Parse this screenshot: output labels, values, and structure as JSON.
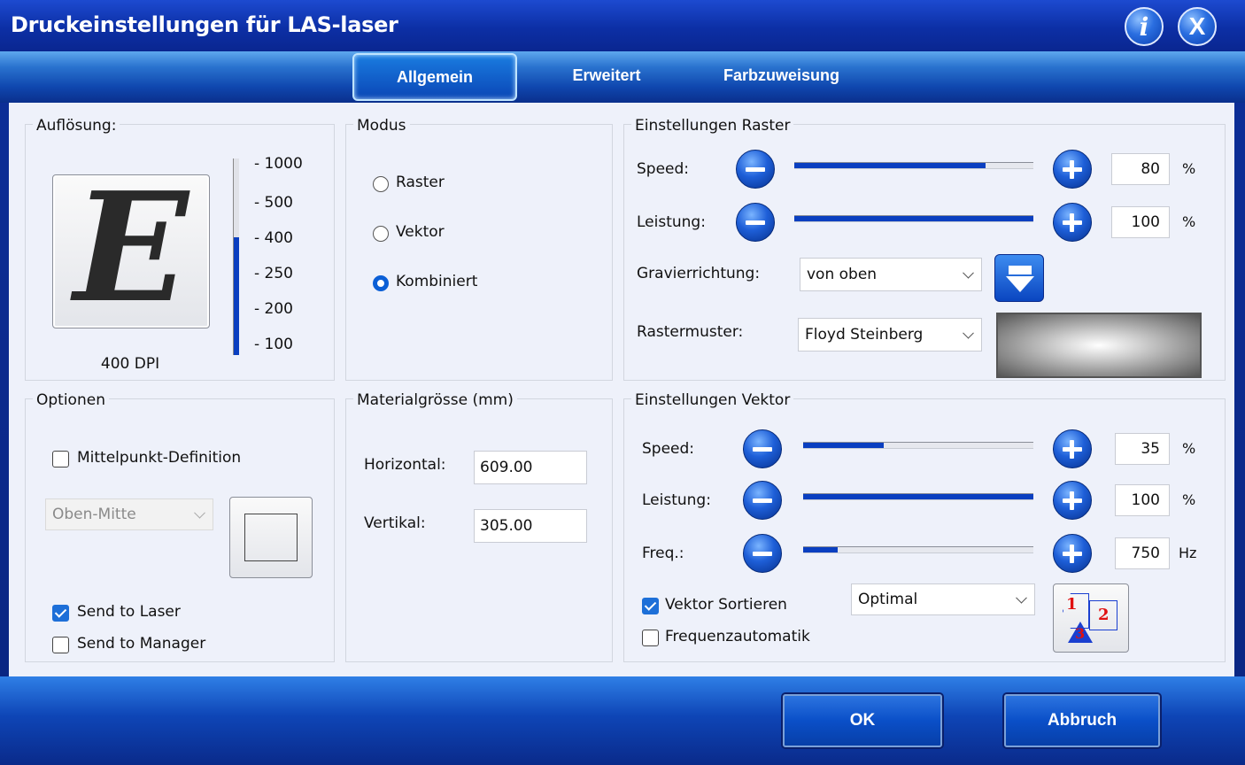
{
  "window": {
    "title": "Druckeinstellungen für LAS-laser",
    "info_label": "i",
    "close_label": "X"
  },
  "tabs": [
    {
      "label": "Allgemein",
      "active": true
    },
    {
      "label": "Erweitert",
      "active": false
    },
    {
      "label": "Farbzuweisung",
      "active": false
    }
  ],
  "resolution": {
    "group_label": "Auflösung:",
    "preview_letter": "E",
    "current": "400 DPI",
    "scale": [
      "1000",
      "500",
      "400",
      "250",
      "200",
      "100"
    ],
    "slider_level_fraction": 0.6
  },
  "modus": {
    "group_label": "Modus",
    "options": [
      {
        "label": "Raster",
        "selected": false
      },
      {
        "label": "Vektor",
        "selected": false
      },
      {
        "label": "Kombiniert",
        "selected": true
      }
    ]
  },
  "raster": {
    "group_label": "Einstellungen Raster",
    "speed_label": "Speed:",
    "speed_value": "80",
    "speed_unit": "%",
    "speed_fraction": 0.8,
    "power_label": "Leistung:",
    "power_value": "100",
    "power_unit": "%",
    "power_fraction": 1.0,
    "direction_label": "Gravierrichtung:",
    "direction_value": "von oben",
    "pattern_label": "Rastermuster:",
    "pattern_value": "Floyd Steinberg"
  },
  "options": {
    "group_label": "Optionen",
    "center_label": "Mittelpunkt-Definition",
    "center_checked": false,
    "position_value": "Oben-Mitte",
    "send_laser_label": "Send to Laser",
    "send_laser_checked": true,
    "send_manager_label": "Send to Manager",
    "send_manager_checked": false
  },
  "material": {
    "group_label": "Materialgrösse (mm)",
    "horizontal_label": "Horizontal:",
    "horizontal_value": "609.00",
    "vertical_label": "Vertikal:",
    "vertical_value": "305.00"
  },
  "vector": {
    "group_label": "Einstellungen Vektor",
    "speed_label": "Speed:",
    "speed_value": "35",
    "speed_unit": "%",
    "speed_fraction": 0.35,
    "power_label": "Leistung:",
    "power_value": "100",
    "power_unit": "%",
    "power_fraction": 1.0,
    "freq_label": "Freq.:",
    "freq_value": "750",
    "freq_unit": "Hz",
    "freq_fraction": 0.15,
    "sort_label": "Vektor Sortieren",
    "sort_checked": true,
    "sort_value": "Optimal",
    "freq_auto_label": "Frequenzautomatik",
    "freq_auto_checked": false,
    "sort_icon_labels": [
      "1",
      "2",
      "3"
    ]
  },
  "footer": {
    "ok_label": "OK",
    "cancel_label": "Abbruch"
  },
  "colors": {
    "accent": "#0a3fc0",
    "title_bar": "#0c2fa5",
    "panel_bg": "#eef1fa"
  }
}
